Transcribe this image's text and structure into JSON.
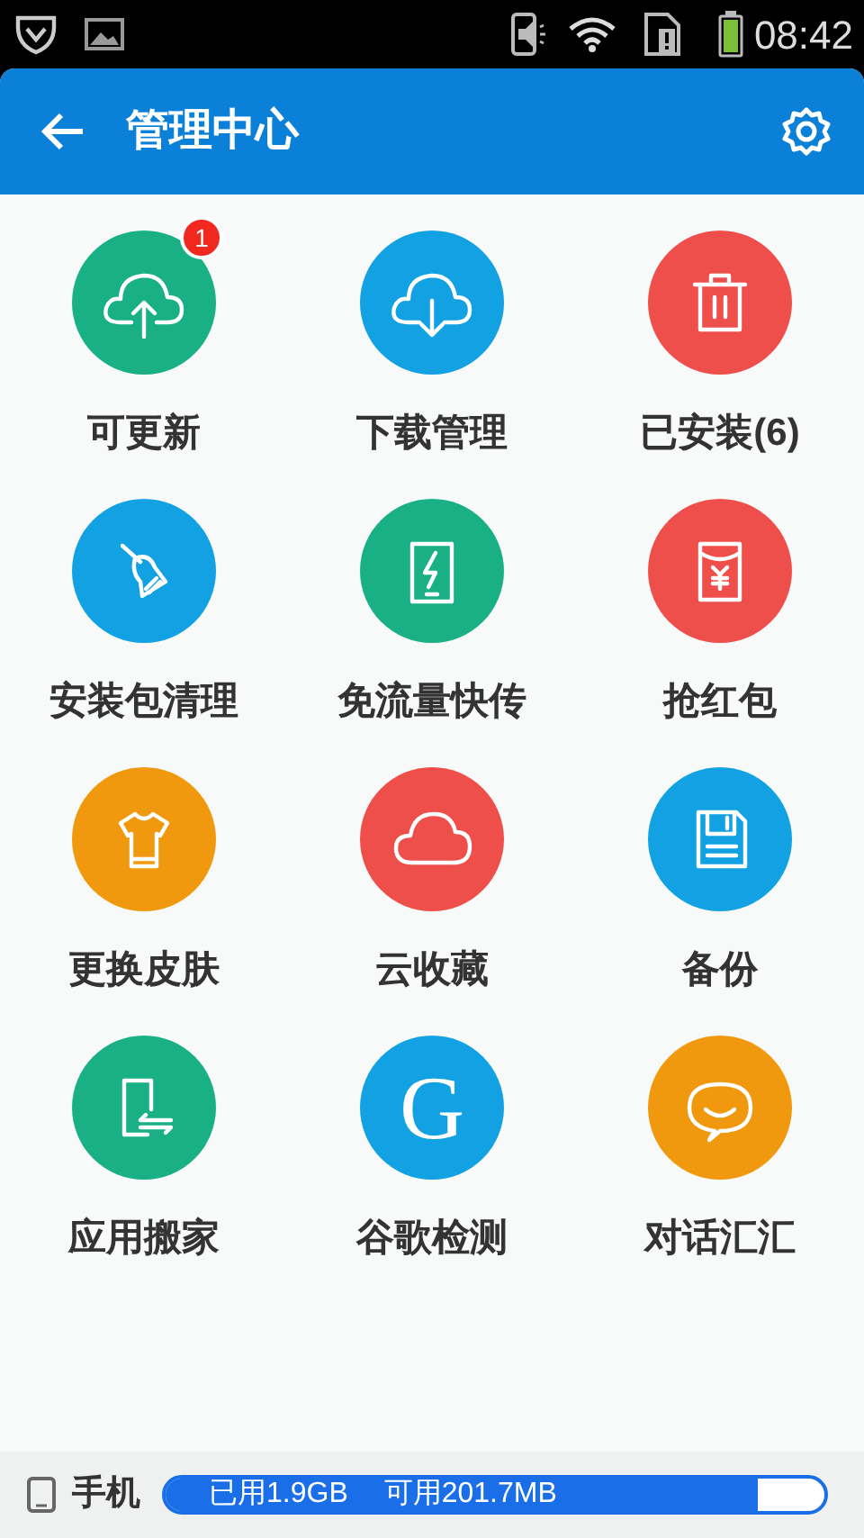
{
  "status_bar": {
    "time": "08:42"
  },
  "header": {
    "title": "管理中心"
  },
  "tools": [
    {
      "label": "可更新",
      "kind": "cloud-up",
      "color": "#19b086",
      "badge": "1"
    },
    {
      "label": "下载管理",
      "kind": "cloud-down",
      "color": "#12a1e3"
    },
    {
      "label": "已安装(6)",
      "kind": "trash",
      "color": "#ef4f4b"
    },
    {
      "label": "安装包清理",
      "kind": "broom",
      "color": "#12a1e3"
    },
    {
      "label": "免流量快传",
      "kind": "phone-bolt",
      "color": "#19b086"
    },
    {
      "label": "抢红包",
      "kind": "envelope",
      "color": "#ef4f4b"
    },
    {
      "label": "更换皮肤",
      "kind": "shirt",
      "color": "#f0990f"
    },
    {
      "label": "云收藏",
      "kind": "cloud",
      "color": "#ef4f4b"
    },
    {
      "label": "备份",
      "kind": "floppy",
      "color": "#12a1e3"
    },
    {
      "label": "应用搬家",
      "kind": "move",
      "color": "#19b086"
    },
    {
      "label": "谷歌检测",
      "kind": "letter",
      "glyph": "G",
      "color": "#12a1e3"
    },
    {
      "label": "对话汇汇",
      "kind": "chat",
      "color": "#f0990f"
    }
  ],
  "storage": {
    "label": "手机",
    "used": "已用1.9GB",
    "free": "可用201.7MB",
    "level": 0.9
  }
}
